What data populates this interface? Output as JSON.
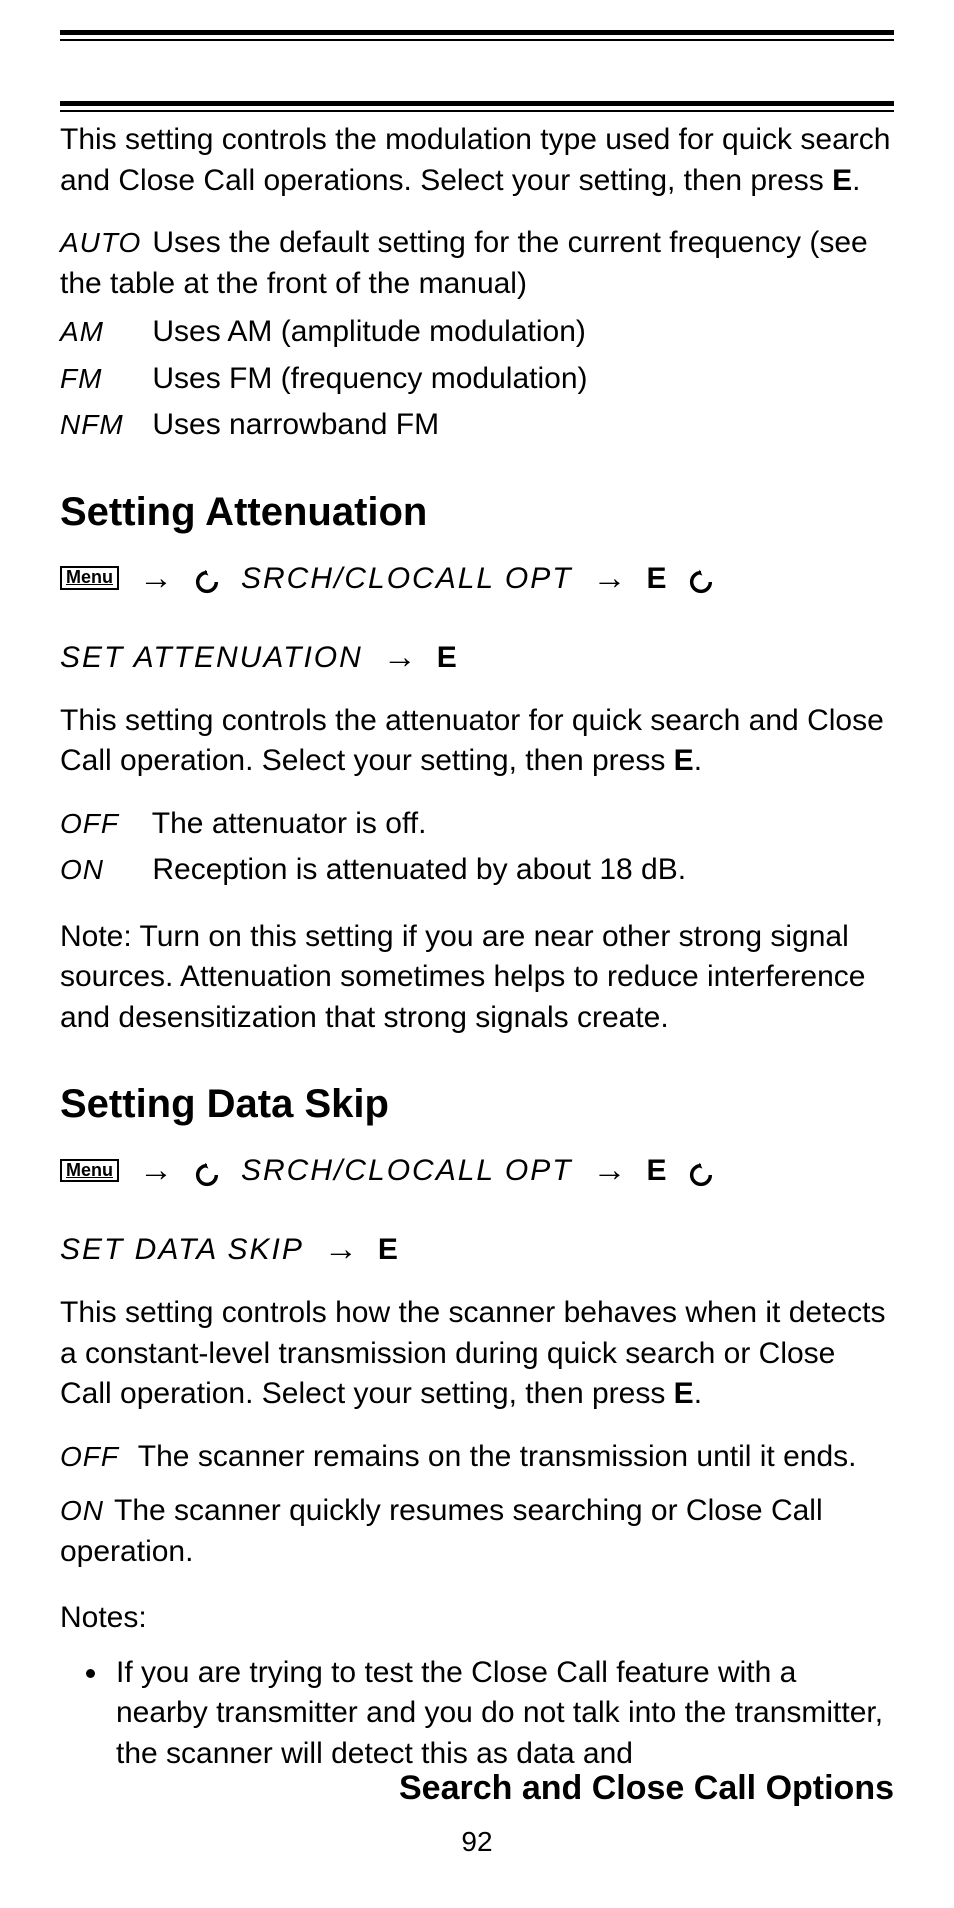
{
  "intro": {
    "p1_a": "This setting controls the modulation type used for quick search and Close Call operations. Select your setting, then press ",
    "p1_b": "E",
    "p1_c": "."
  },
  "mod_options": {
    "auto_label": "AUTO",
    "auto_text": "Uses the default setting for the current frequency (see the table at the front of the manual)",
    "am_label": "AM",
    "am_text": "Uses AM (amplitude modulation)",
    "fm_label": "FM",
    "fm_text": "Uses FM (frequency modulation)",
    "nfm_label": "NFM",
    "nfm_text": "Uses narrowband FM"
  },
  "attn": {
    "heading": "Setting Attenuation",
    "menu_label": "Menu",
    "path1": "SRCH/CLOCALL OPT",
    "path2": "SET ATTENUATION",
    "e": "E",
    "p_a": "This setting controls the attenuator for quick search and Close Call operation. Select your setting, then press ",
    "p_b": "E",
    "p_c": ".",
    "off_label": "OFF",
    "off_text": "The attenuator is off.",
    "on_label": "ON",
    "on_text": "Reception is attenuated by about 18 dB.",
    "note": "Note: Turn on this setting if you are near other strong signal sources. Attenuation sometimes helps to reduce interference and desensitization that strong signals create."
  },
  "dskip": {
    "heading": "Setting Data Skip",
    "menu_label": "Menu",
    "path1": "SRCH/CLOCALL OPT",
    "path2": "SET DATA SKIP",
    "e": "E",
    "p_a": "This setting controls how the scanner behaves when it detects a constant-level transmission during quick search or Close Call operation. Select your setting, then press ",
    "p_b": "E",
    "p_c": ".",
    "off_label": "OFF",
    "off_text": "The scanner remains on the transmission until it ends.",
    "on_label": "ON",
    "on_text": "The scanner quickly resumes searching or Close Call operation.",
    "notes_label": "Notes:",
    "note1": "If you are trying to test the Close Call feature with a nearby transmitter and you do not talk into the transmitter, the scanner will detect this as data and"
  },
  "footer": {
    "title": "Search and Close Call Options",
    "page": "92"
  }
}
